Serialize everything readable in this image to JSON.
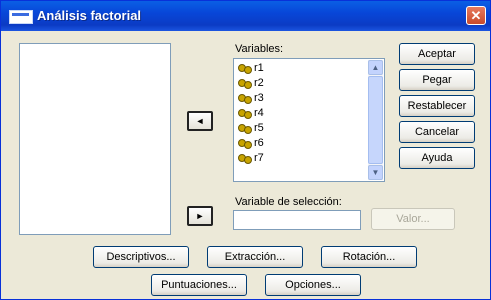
{
  "window": {
    "title": "Análisis factorial",
    "close_glyph": "✕"
  },
  "variables": {
    "label": "Variables:",
    "items": [
      "r1",
      "r2",
      "r3",
      "r4",
      "r5",
      "r6",
      "r7"
    ],
    "icon": "scale-variable-icon"
  },
  "selection": {
    "label": "Variable de selección:",
    "value_button": "Valor..."
  },
  "arrows": {
    "move_to_variables": "◄",
    "move_to_selection": "►"
  },
  "side_buttons": {
    "accept": "Aceptar",
    "paste": "Pegar",
    "reset": "Restablecer",
    "cancel": "Cancelar",
    "help": "Ayuda"
  },
  "bottom_buttons": {
    "descriptives": "Descriptivos...",
    "extraction": "Extracción...",
    "rotation": "Rotación...",
    "scores": "Puntuaciones...",
    "options": "Opciones..."
  },
  "scrollbar": {
    "up": "▲",
    "down": "▼"
  }
}
